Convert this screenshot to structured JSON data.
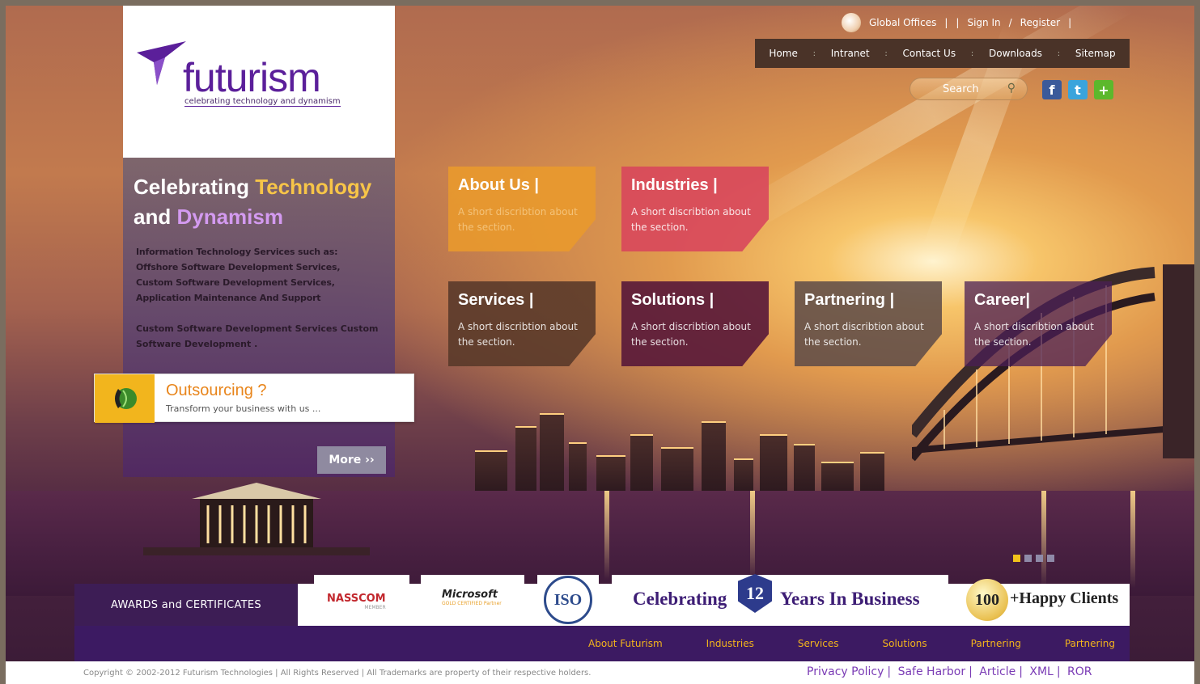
{
  "logo": {
    "name": "futurism",
    "tagline": "celebrating technology and dynamism"
  },
  "header": {
    "global_offices": "Global Offices",
    "sep1": "|",
    "sep2": "|",
    "sign_in": "Sign In",
    "slash": "/",
    "register": "Register",
    "sep3": "|"
  },
  "nav": {
    "items": [
      "Home",
      "Intranet",
      "Contact Us",
      "Downloads",
      "Sitemap"
    ]
  },
  "search": {
    "placeholder": "Search"
  },
  "social": [
    "facebook-icon",
    "twitter-icon",
    "add-icon"
  ],
  "hero": {
    "line1_white": "Celebrating",
    "line1_yellow": "Technology",
    "line2_white": "and",
    "line2_purple": "Dynamism",
    "para1": "Information Technology Services such as: Offshore Software Development Services, Custom Software Development Services, Application Maintenance And Support",
    "para2": "Custom Software Development Services Custom Software Development .",
    "more": "More ››"
  },
  "outsourcing": {
    "title": "Outsourcing ?",
    "subtitle": "Transform your business with us ..."
  },
  "tiles": [
    {
      "title": "About Us |",
      "desc": "A short discribtion about the section.",
      "color": "#e99a2c"
    },
    {
      "title": "Industries |",
      "desc": "A short discribtion about the section.",
      "color": "#d8475c"
    },
    {
      "title": "Services |",
      "desc": "A short discribtion about the section.",
      "color": "#5a3a2a"
    },
    {
      "title": "Solutions |",
      "desc": "A short discribtion about the section.",
      "color": "#5a1a3a"
    },
    {
      "title": "Partnering |",
      "desc": "A short discribtion about the section.",
      "color": "#5c4a48"
    },
    {
      "title": "Career|",
      "desc": "A short discribtion about the section.",
      "color": "#4b1f55"
    }
  ],
  "awards": {
    "label": "AWARDS and CERTIFICATES",
    "nasscom": "NASSCOM",
    "nasscom_sub": "MEMBER",
    "microsoft": "Microsoft",
    "microsoft_sub": "GOLD CERTIFIED Partner",
    "iso": "ISO",
    "celebrating": "Celebrating",
    "years_num": "12",
    "years_text": "Years In Business",
    "hundred": "100",
    "happy": "+Happy Clients"
  },
  "footer_nav": [
    "About Futurism",
    "Industries",
    "Services",
    "Solutions",
    "Partnering",
    "Partnering"
  ],
  "footer": {
    "copyright": "Copyright © 2002-2012 Futurism Technologies | All Rights Reserved   | All Trademarks are property of their respective holders.",
    "links": [
      "Privacy Policy",
      "Safe Harbor",
      "Article",
      "XML",
      "ROR"
    ]
  },
  "slider": {
    "count": 4,
    "active": 1
  },
  "colors": {
    "brand": "#5b1f9a",
    "accent": "#f3b41c",
    "navbar": "#4a3328"
  }
}
